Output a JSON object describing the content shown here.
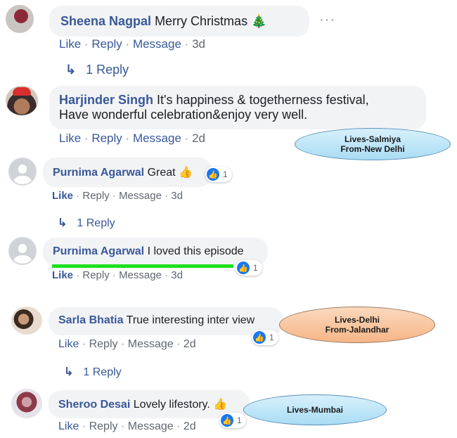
{
  "comments": [
    {
      "name": "Sheena Nagpal",
      "text": "Merry Christmas",
      "emoji": "🎄",
      "actions": [
        "Like",
        "Reply",
        "Message",
        "3d"
      ],
      "replies": "1 Reply"
    },
    {
      "name": "Harjinder Singh",
      "text_line1": "It's happiness & togetherness festival,",
      "text_line2": "Have wonderful celebration&enjoy very well.",
      "actions": [
        "Like",
        "Reply",
        "Message",
        "2d"
      ]
    },
    {
      "name": "Purnima Agarwal",
      "text": "Great",
      "emoji": "👍",
      "reactions": "1",
      "actions": [
        "Like",
        "Reply",
        "Message",
        "3d"
      ],
      "replies": "1 Reply"
    },
    {
      "name": "Purnima Agarwal",
      "text": "I loved this episode",
      "reactions": "1",
      "actions": [
        "Like",
        "Reply",
        "Message",
        "3d"
      ]
    },
    {
      "name": "Sarla Bhatia",
      "text": "True interesting inter view",
      "reactions": "1",
      "actions": [
        "Like",
        "Reply",
        "Message",
        "2d"
      ],
      "replies": "1 Reply"
    },
    {
      "name": "Sheroo Desai",
      "text": "Lovely lifestory.",
      "emoji": "👍",
      "reactions": "1",
      "actions": [
        "Like",
        "Reply",
        "Message",
        "2d"
      ]
    }
  ],
  "annotations": [
    {
      "line1": "Lives-Salmiya",
      "line2": "From-New Delhi"
    },
    {
      "line1": "Lives-Delhi",
      "line2": "From-Jalandhar"
    },
    {
      "line1": "Lives-Mumbai"
    }
  ],
  "ui": {
    "separator": "·",
    "more": "···",
    "reply_arrow": "↳",
    "like_glyph": "👍"
  },
  "colors": {
    "name": "#385898",
    "bubble": "#f2f3f5",
    "meta": "#606770",
    "like_blue": "#1877f2",
    "highlight_line": "#1ee01e"
  }
}
